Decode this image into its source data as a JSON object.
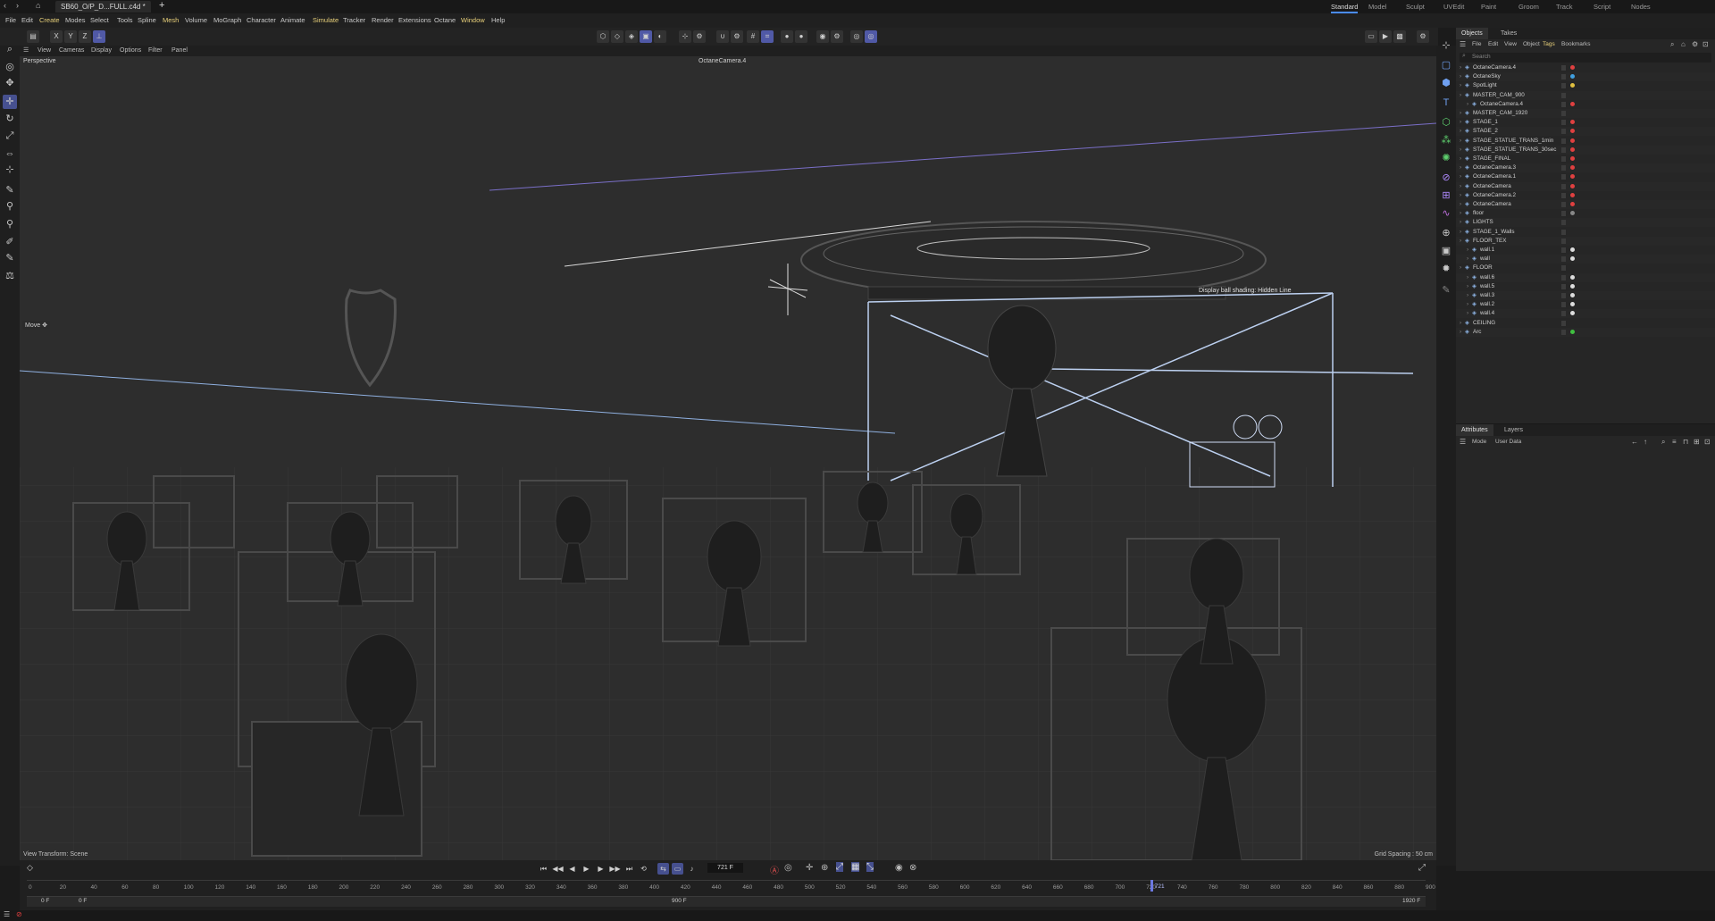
{
  "doc_tab": "SB60_O/P_D...FULL.c4d *",
  "workspaces": [
    {
      "label": "Standard",
      "active": true
    },
    {
      "label": "Model"
    },
    {
      "label": "Sculpt"
    },
    {
      "label": "UVEdit"
    },
    {
      "label": "Paint"
    },
    {
      "label": "Groom"
    },
    {
      "label": "Track"
    },
    {
      "label": "Script"
    },
    {
      "label": "Nodes"
    }
  ],
  "menus": [
    {
      "label": "File"
    },
    {
      "label": "Edit"
    },
    {
      "label": "Create",
      "hl": true
    },
    {
      "label": "Modes"
    },
    {
      "label": "Select"
    },
    {
      "label": "Tools"
    },
    {
      "label": "Spline"
    },
    {
      "label": "Mesh",
      "hl": true
    },
    {
      "label": "Volume"
    },
    {
      "label": "MoGraph"
    },
    {
      "label": "Character"
    },
    {
      "label": "Animate"
    },
    {
      "label": "Simulate",
      "hl": true
    },
    {
      "label": "Tracker"
    },
    {
      "label": "Render"
    },
    {
      "label": "Extensions"
    },
    {
      "label": "Octane"
    },
    {
      "label": "Window",
      "hl": true
    },
    {
      "label": "Help"
    }
  ],
  "axis_buttons": [
    "X",
    "Y",
    "Z"
  ],
  "viewport_menu": [
    "View",
    "Cameras",
    "Display",
    "Options",
    "Filter",
    "Panel"
  ],
  "viewport": {
    "label": "Perspective",
    "camera": "OctaneCamera.4",
    "view_transform": "View Transform: Scene",
    "grid_spacing": "Grid Spacing : 50 cm",
    "tool_hint": "Move",
    "tooltip": "Display ball shading: Hidden Line"
  },
  "timeline": {
    "ticks": [
      "0",
      "20",
      "40",
      "60",
      "80",
      "100",
      "120",
      "140",
      "160",
      "180",
      "200",
      "220",
      "240",
      "260",
      "280",
      "300",
      "320",
      "340",
      "360",
      "380",
      "400",
      "420",
      "440",
      "460",
      "480",
      "500",
      "520",
      "540",
      "560",
      "580",
      "600",
      "620",
      "640",
      "660",
      "680",
      "700",
      "720",
      "740",
      "760",
      "780",
      "800",
      "820",
      "840",
      "860",
      "880",
      "900"
    ],
    "current_frame": "721 F",
    "playhead_label": "721",
    "playhead_fraction": 0.801,
    "start": "0 F",
    "start2": "0 F",
    "mid": "900 F",
    "end": "1920 F"
  },
  "panel_tabs": [
    "Objects",
    "Takes"
  ],
  "panel_menu": [
    {
      "label": "File"
    },
    {
      "label": "Edit"
    },
    {
      "label": "View"
    },
    {
      "label": "Object"
    },
    {
      "label": "Tags",
      "hl": true
    },
    {
      "label": "Bookmarks"
    }
  ],
  "search_placeholder": "Search",
  "objects": [
    {
      "name": "OctaneCamera.4",
      "indent": 0,
      "tag": "#e04040"
    },
    {
      "name": "OctaneSky",
      "indent": 0,
      "tag": "#40a0e0"
    },
    {
      "name": "SpotLight",
      "indent": 0,
      "tag": "#e0c040"
    },
    {
      "name": "MASTER_CAM_900",
      "indent": 0,
      "tag": ""
    },
    {
      "name": "OctaneCamera.4",
      "indent": 1,
      "tag": "#e04040"
    },
    {
      "name": "MASTER_CAM_1920",
      "indent": 0,
      "tag": ""
    },
    {
      "name": "STAGE_1",
      "indent": 0,
      "tag": "#e04040"
    },
    {
      "name": "STAGE_2",
      "indent": 0,
      "tag": "#e04040"
    },
    {
      "name": "STAGE_STATUE_TRANS_1min",
      "indent": 0,
      "tag": "#e04040"
    },
    {
      "name": "STAGE_STATUE_TRANS_30sec",
      "indent": 0,
      "tag": "#e04040"
    },
    {
      "name": "STAGE_FINAL",
      "indent": 0,
      "tag": "#e04040"
    },
    {
      "name": "OctaneCamera.3",
      "indent": 0,
      "tag": "#e04040"
    },
    {
      "name": "OctaneCamera.1",
      "indent": 0,
      "tag": "#e04040"
    },
    {
      "name": "OctaneCamera",
      "indent": 0,
      "tag": "#e04040"
    },
    {
      "name": "OctaneCamera.2",
      "indent": 0,
      "tag": "#e04040"
    },
    {
      "name": "OctaneCamera",
      "indent": 0,
      "tag": "#e04040"
    },
    {
      "name": "floor",
      "indent": 0,
      "tag": "#888888"
    },
    {
      "name": "LIGHTS",
      "indent": 0,
      "tag": ""
    },
    {
      "name": "STAGE_1_Walls",
      "indent": 0,
      "tag": ""
    },
    {
      "name": "FLOOR_TEX",
      "indent": 0,
      "tag": ""
    },
    {
      "name": "wall.1",
      "indent": 1,
      "tag": "#dddddd"
    },
    {
      "name": "wall",
      "indent": 1,
      "tag": "#dddddd"
    },
    {
      "name": "FLOOR",
      "indent": 0,
      "tag": ""
    },
    {
      "name": "wall.6",
      "indent": 1,
      "tag": "#dddddd"
    },
    {
      "name": "wall.5",
      "indent": 1,
      "tag": "#dddddd"
    },
    {
      "name": "wall.3",
      "indent": 1,
      "tag": "#dddddd"
    },
    {
      "name": "wall.2",
      "indent": 1,
      "tag": "#dddddd"
    },
    {
      "name": "wall.4",
      "indent": 1,
      "tag": "#dddddd"
    },
    {
      "name": "CEILING",
      "indent": 0,
      "tag": ""
    },
    {
      "name": "Arc",
      "indent": 0,
      "tag": "#40c040"
    }
  ],
  "attr_tabs": [
    "Attributes",
    "Layers"
  ],
  "attr_menu": [
    "Mode",
    "User Data"
  ]
}
